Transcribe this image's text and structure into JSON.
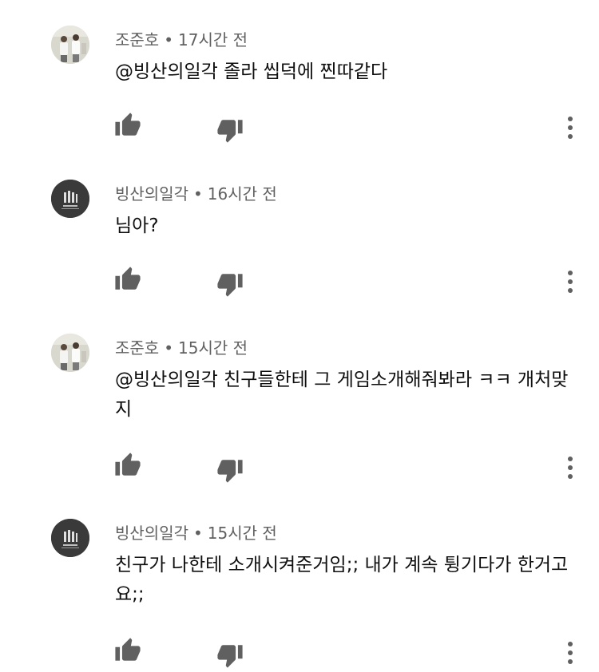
{
  "comments": [
    {
      "author": "조준호",
      "separator": "•",
      "time": "17시간 전",
      "text": "@빙산의일각 졸라 씹덕에 찐따같다",
      "avatar": "photo-avatar"
    },
    {
      "author": "빙산의일각",
      "separator": "•",
      "time": "16시간 전",
      "text": "님아?",
      "avatar": "logo-avatar"
    },
    {
      "author": "조준호",
      "separator": "•",
      "time": "15시간 전",
      "text": "@빙산의일각 친구들한테 그 게임소개해줘봐라 ㅋㅋ 개처맞지",
      "avatar": "photo-avatar"
    },
    {
      "author": "빙산의일각",
      "separator": "•",
      "time": "15시간 전",
      "text": "친구가 나한테 소개시켜준거임;; 내가 계속 튕기다가 한거고요;;",
      "avatar": "logo-avatar"
    }
  ],
  "icons": {
    "like": "thumbs-up-icon",
    "dislike": "thumbs-down-icon",
    "more": "more-vert-icon"
  },
  "colors": {
    "meta_text": "#606060",
    "icon": "#606060",
    "body_text": "#0f0f0f"
  }
}
